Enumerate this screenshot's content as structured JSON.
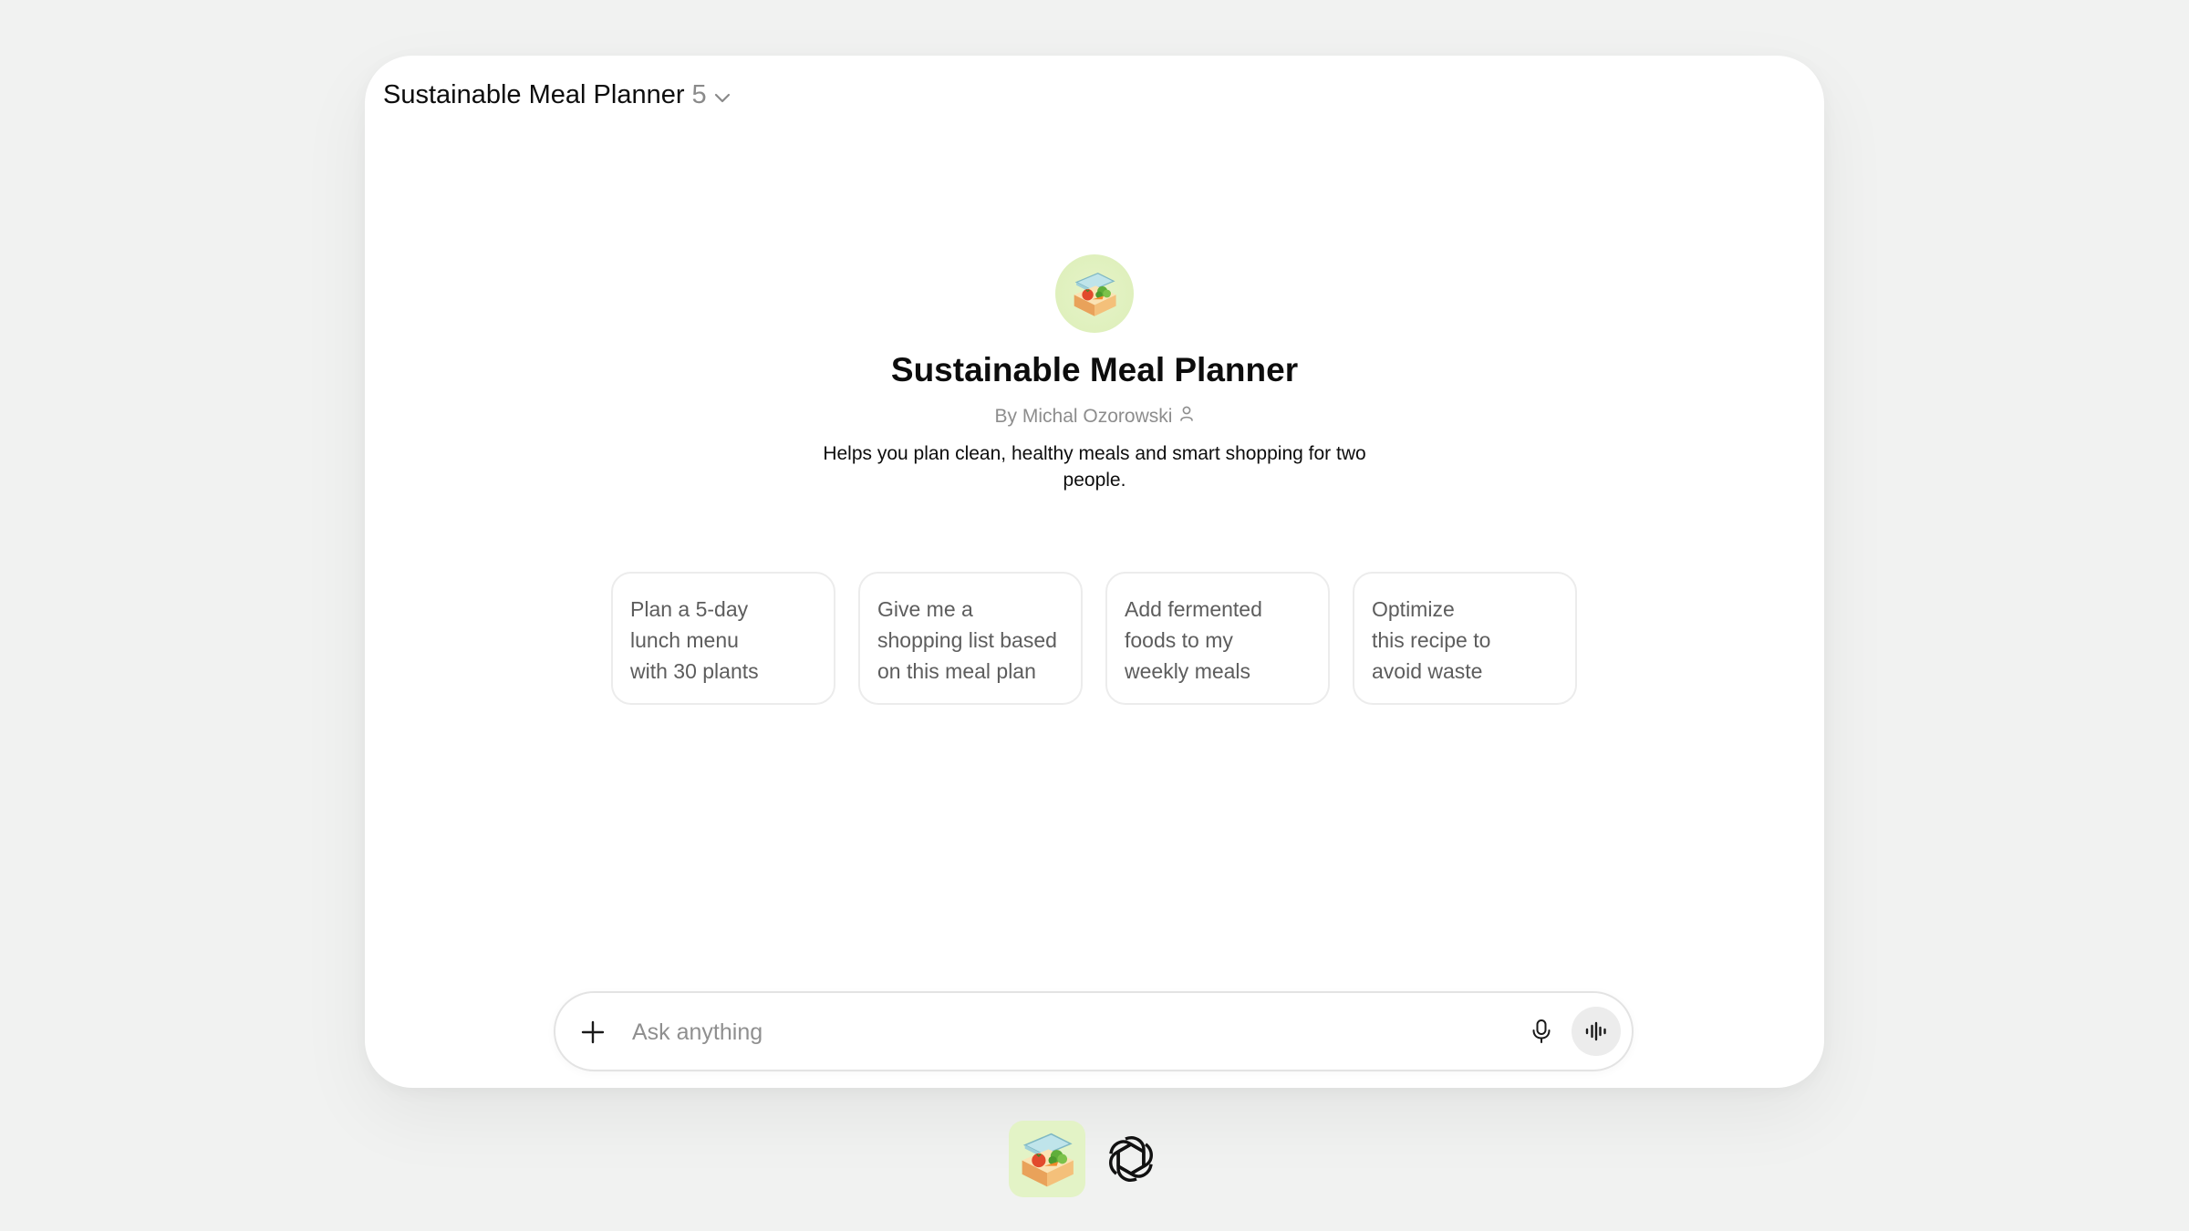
{
  "header": {
    "model_name": "Sustainable Meal Planner",
    "model_version": "5"
  },
  "gpt": {
    "title": "Sustainable Meal Planner",
    "author": "By Michal Ozorowski",
    "description": "Helps you plan clean, healthy meals and smart shopping for two people.",
    "icon": "lunchbox-icon"
  },
  "starters": [
    {
      "label": "Plan a 5-day\nlunch menu\nwith 30 plants"
    },
    {
      "label": "Give me a\nshopping list based\non this meal plan"
    },
    {
      "label": "Add fermented\nfoods to my\nweekly meals"
    },
    {
      "label": "Optimize\nthis recipe to\navoid waste"
    }
  ],
  "composer": {
    "placeholder": "Ask anything",
    "value": ""
  },
  "colors": {
    "background": "#f1f2f1",
    "avatar_bg": "#e3f3c6",
    "muted_text": "#8d8d8d"
  }
}
